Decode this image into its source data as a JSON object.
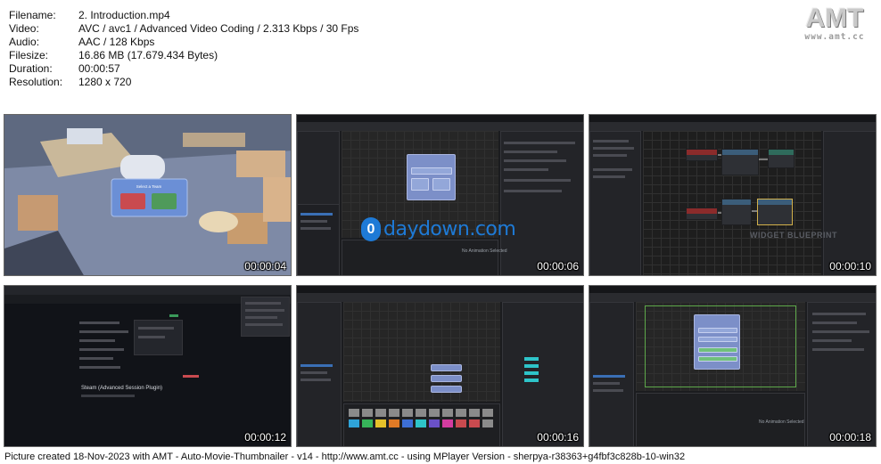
{
  "info": {
    "rows": [
      {
        "key": "Filename:",
        "value": "2. Introduction.mp4"
      },
      {
        "key": "Video:",
        "value": "AVC / avc1 / Advanced Video Coding / 2.313 Kbps / 30 Fps"
      },
      {
        "key": "Audio:",
        "value": "AAC / 128 Kbps"
      },
      {
        "key": "Filesize:",
        "value": "16.86 MB (17.679.434 Bytes)"
      },
      {
        "key": "Duration:",
        "value": "00:00:57"
      },
      {
        "key": "Resolution:",
        "value": "1280 x 720"
      }
    ]
  },
  "logo": {
    "mark": "AMT",
    "url": "www.amt.cc"
  },
  "thumbnails": [
    {
      "timestamp": "00:00:04",
      "scene": "game-viewport"
    },
    {
      "timestamp": "00:00:06",
      "scene": "widget-designer"
    },
    {
      "timestamp": "00:00:10",
      "scene": "widget-blueprint"
    },
    {
      "timestamp": "00:00:12",
      "scene": "plugin-page"
    },
    {
      "timestamp": "00:00:16",
      "scene": "widget-designer-colors"
    },
    {
      "timestamp": "00:00:18",
      "scene": "widget-designer-canvas"
    }
  ],
  "thumb_text": {
    "game_title": "Select a Team",
    "no_animation": "No Animation Selected",
    "widget_blueprint": "WIDGET BLUEPRINT",
    "plugin_title": "Steam (Advanced Session Plugin)"
  },
  "watermark": {
    "text": "daydown.com",
    "glyph": "0"
  },
  "footer": {
    "text": "Picture created 18-Nov-2023 with AMT - Auto-Movie-Thumbnailer - v14 - http://www.amt.cc - using MPlayer Version - sherpya-r38363+g4fbf3c828b-10-win32"
  },
  "colors": {
    "accent_blue": "#1e7ad6",
    "node_blue": "#7c8fc8",
    "team_red": "#c94a4f",
    "team_green": "#4f9a5a",
    "editor_bg": "#262626"
  }
}
